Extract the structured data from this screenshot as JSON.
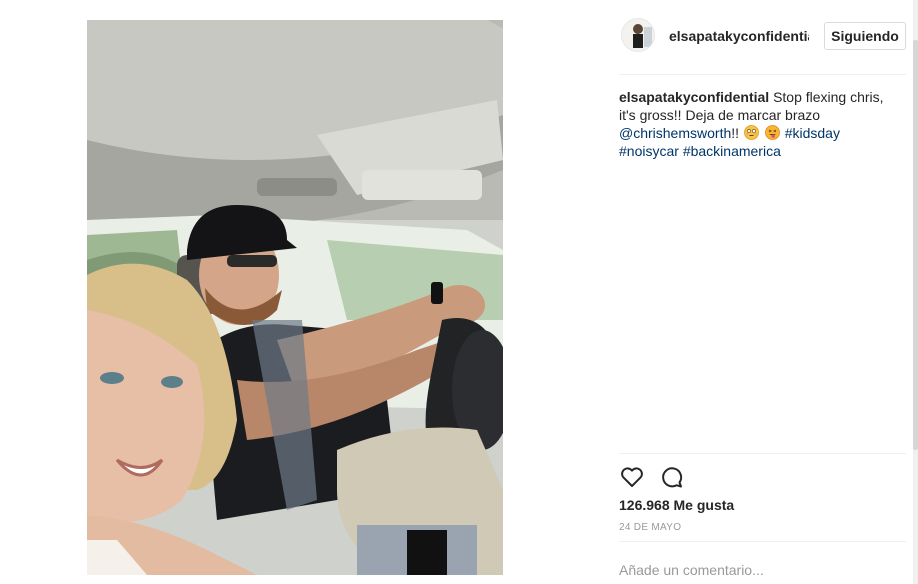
{
  "post": {
    "username": "elsapatakyconfidential",
    "follow_label": "Siguiendo",
    "caption": {
      "text_line1": "Stop flexing chris,",
      "text_line2": "it's gross!! Deja de marcar brazo",
      "mention": "@chrishemsworth",
      "mention_suffix": "!!",
      "hashtag_kidsday": "#kidsday",
      "hashtag_noisycar": "#noisycar",
      "hashtag_backinamerica": "#backinamerica"
    },
    "likes_text": "126.968 Me gusta",
    "date_text": "24 DE MAYO",
    "comment_placeholder": "Añade un comentario..."
  },
  "icons": {
    "like": "heart-outline-icon",
    "comment": "speech-bubble-icon",
    "emoji_1": "flushed-face-emoji",
    "emoji_2": "tongue-face-emoji"
  },
  "colors": {
    "link": "#003569",
    "text": "#262626",
    "muted": "#999999",
    "border": "#dbdbdb"
  }
}
